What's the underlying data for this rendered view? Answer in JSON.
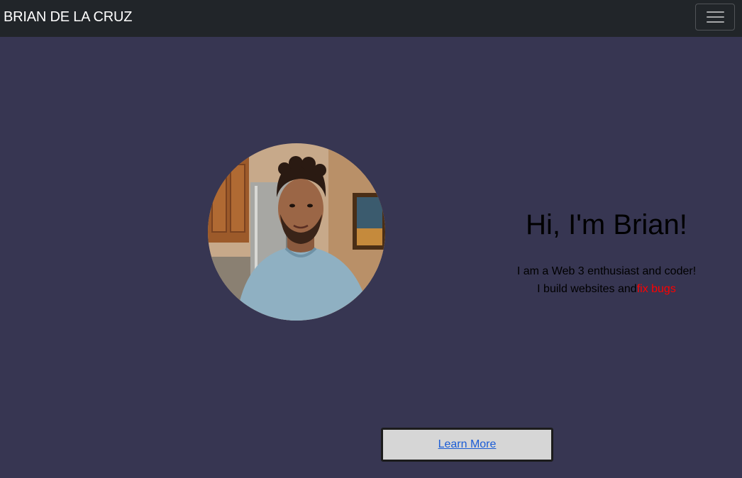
{
  "navbar": {
    "brand": "BRIAN DE LA CRUZ",
    "toggle_icon": "hamburger-menu-icon"
  },
  "hero": {
    "photo_alt": "Brian",
    "headline": "Hi, I'm Brian!",
    "line1": "I am a Web 3 enthusiast and coder!",
    "line2_prefix": "I build websites and",
    "line2_highlight": "fix bugs"
  },
  "cta": {
    "label": "Learn More"
  },
  "colors": {
    "navbar_bg": "#212529",
    "page_bg": "#373652",
    "highlight": "#ff0000",
    "button_bg": "#d6d6d6",
    "link": "#1a5cd6"
  }
}
